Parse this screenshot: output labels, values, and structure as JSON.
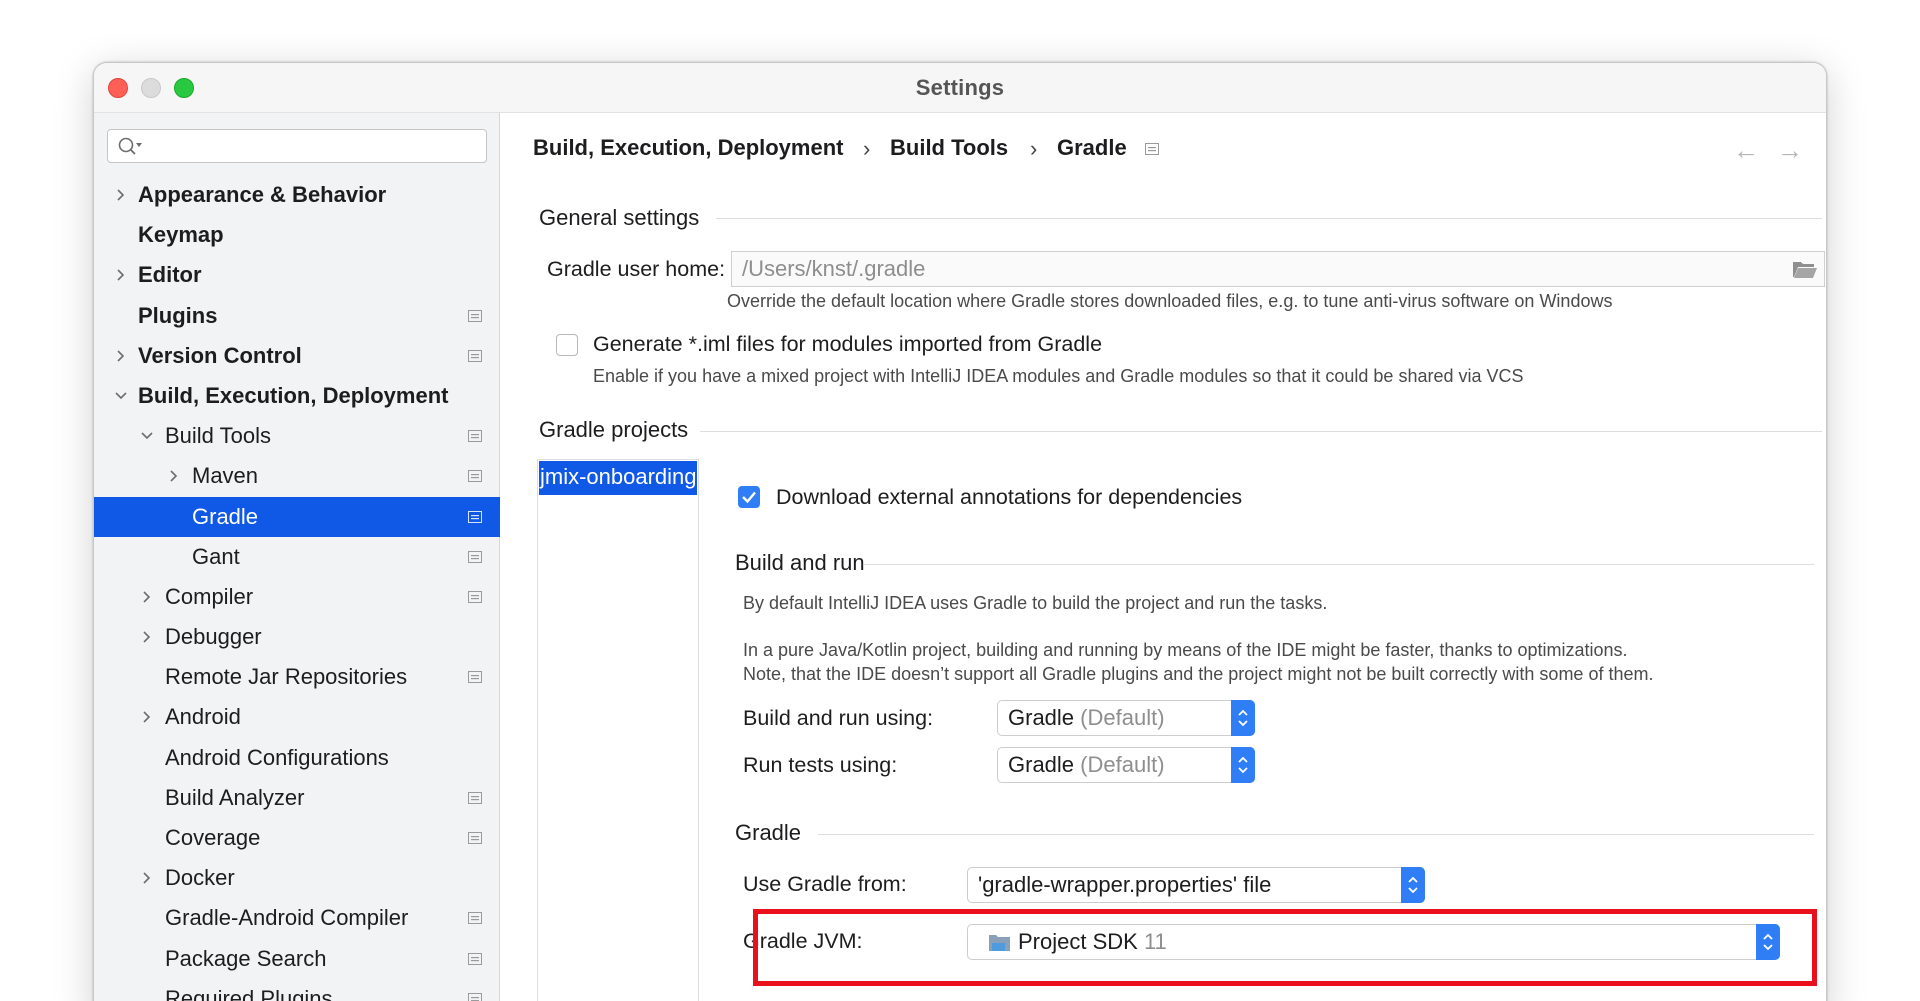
{
  "window": {
    "title": "Settings"
  },
  "search": {
    "placeholder": ""
  },
  "sidebar": {
    "items": [
      {
        "label": "Appearance & Behavior"
      },
      {
        "label": "Keymap"
      },
      {
        "label": "Editor"
      },
      {
        "label": "Plugins"
      },
      {
        "label": "Version Control"
      },
      {
        "label": "Build, Execution, Deployment"
      },
      {
        "label": "Build Tools"
      },
      {
        "label": "Maven"
      },
      {
        "label": "Gradle"
      },
      {
        "label": "Gant"
      },
      {
        "label": "Compiler"
      },
      {
        "label": "Debugger"
      },
      {
        "label": "Remote Jar Repositories"
      },
      {
        "label": "Android"
      },
      {
        "label": "Android Configurations"
      },
      {
        "label": "Build Analyzer"
      },
      {
        "label": "Coverage"
      },
      {
        "label": "Docker"
      },
      {
        "label": "Gradle-Android Compiler"
      },
      {
        "label": "Package Search"
      },
      {
        "label": "Required Plugins"
      }
    ]
  },
  "breadcrumb": {
    "items": [
      "Build, Execution, Deployment",
      "Build Tools",
      "Gradle"
    ],
    "separator": "›"
  },
  "nav": {
    "back": "←",
    "forward": "→"
  },
  "general": {
    "title": "General settings",
    "user_home_label": "Gradle user home:",
    "user_home_value": "/Users/knst/.gradle",
    "user_home_hint": "Override the default location where Gradle stores downloaded files, e.g. to tune anti-virus software on Windows",
    "iml_label": "Generate *.iml files for modules imported from Gradle",
    "iml_checked": false,
    "iml_hint": "Enable if you have a mixed project with IntelliJ IDEA modules and Gradle modules so that it could be shared via VCS"
  },
  "projects": {
    "title": "Gradle projects",
    "list": [
      "jmix-onboarding"
    ],
    "download_annotations_label": "Download external annotations for dependencies",
    "download_annotations_checked": true
  },
  "build_and_run": {
    "title": "Build and run",
    "desc1": "By default IntelliJ IDEA uses Gradle to build the project and run the tasks.",
    "desc2": "In a pure Java/Kotlin project, building and running by means of the IDE might be faster, thanks to optimizations.",
    "desc3": "Note, that the IDE doesn’t support all Gradle plugins and the project might not be built correctly with some of them.",
    "build_using_label": "Build and run using:",
    "build_using_value": "Gradle",
    "build_using_suffix": "(Default)",
    "tests_using_label": "Run tests using:",
    "tests_using_value": "Gradle",
    "tests_using_suffix": "(Default)"
  },
  "gradle": {
    "title": "Gradle",
    "use_from_label": "Use Gradle from:",
    "use_from_value": "'gradle-wrapper.properties' file",
    "jvm_label": "Gradle JVM:",
    "jvm_value": "Project SDK",
    "jvm_version": "11"
  },
  "colors": {
    "selection": "#1058e6",
    "accent": "#2f7ef5",
    "highlight": "#e8111b"
  }
}
